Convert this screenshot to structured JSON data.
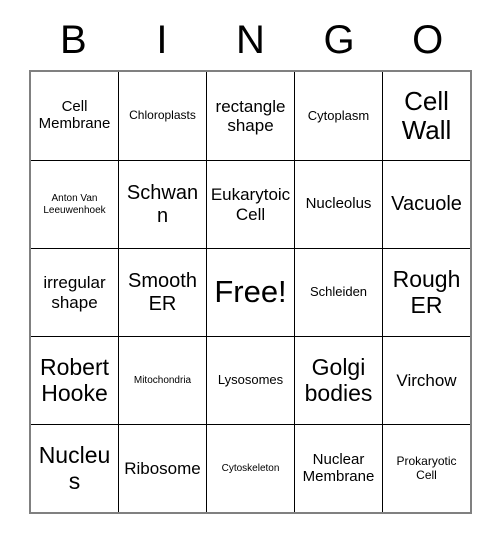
{
  "card": {
    "title": "Bingo Card",
    "header_letters": [
      "B",
      "I",
      "N",
      "G",
      "O"
    ],
    "columns": 5,
    "rows": 5,
    "free_space_label": "Free!",
    "colors": {
      "outer_border": "#808080",
      "inner_grid_line": "#000000",
      "cell_background": "#ffffff",
      "text": "#000000"
    },
    "cells": [
      [
        {
          "text": "Cell Membrane",
          "size": "m"
        },
        {
          "text": "Chloroplasts",
          "size": "s"
        },
        {
          "text": "rectangle shape",
          "size": "ml"
        },
        {
          "text": "Cytoplasm",
          "size": "sm"
        },
        {
          "text": "Cell Wall",
          "size": "xxl"
        }
      ],
      [
        {
          "text": "Anton Van Leeuwenhoek",
          "size": "xs"
        },
        {
          "text": "Schwann",
          "size": "l"
        },
        {
          "text": "Eukarytoic Cell",
          "size": "ml"
        },
        {
          "text": "Nucleolus",
          "size": "m"
        },
        {
          "text": "Vacuole",
          "size": "l"
        }
      ],
      [
        {
          "text": "irregular shape",
          "size": "ml"
        },
        {
          "text": "Smooth ER",
          "size": "l"
        },
        {
          "text": "Free!",
          "size": "free"
        },
        {
          "text": "Schleiden",
          "size": "sm"
        },
        {
          "text": "Rough ER",
          "size": "xl"
        }
      ],
      [
        {
          "text": "Robert Hooke",
          "size": "xl"
        },
        {
          "text": "Mitochondria",
          "size": "xs"
        },
        {
          "text": "Lysosomes",
          "size": "sm"
        },
        {
          "text": "Golgi bodies",
          "size": "xl"
        },
        {
          "text": "Virchow",
          "size": "ml"
        }
      ],
      [
        {
          "text": "Nucleus",
          "size": "xl"
        },
        {
          "text": "Ribosome",
          "size": "ml"
        },
        {
          "text": "Cytoskeleton",
          "size": "xs"
        },
        {
          "text": "Nuclear Membrane",
          "size": "m"
        },
        {
          "text": "Prokaryotic Cell",
          "size": "s"
        }
      ]
    ]
  }
}
